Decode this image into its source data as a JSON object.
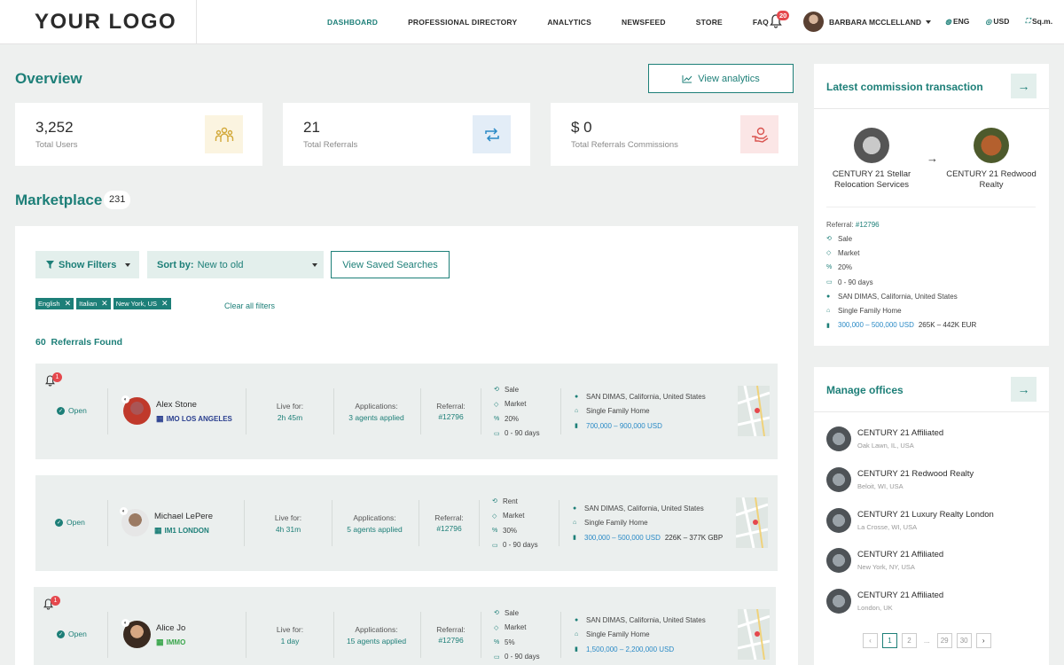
{
  "header": {
    "logo": "YOUR LOGO",
    "nav": [
      "DASHBOARD",
      "PROFESSIONAL DIRECTORY",
      "ANALYTICS",
      "NEWSFEED",
      "STORE",
      "FAQ"
    ],
    "notification_count": "20",
    "user_name": "BARBARA MCCLELLAND",
    "language": "ENG",
    "currency": "USD",
    "unit": "Sq.m."
  },
  "overview": {
    "title": "Overview",
    "view_analytics": "View analytics",
    "stats": [
      {
        "value": "3,252",
        "label": "Total Users",
        "icon": "users-icon"
      },
      {
        "value": "21",
        "label": "Total Referrals",
        "icon": "repeat-icon"
      },
      {
        "value": "$ 0",
        "label": "Total Referrals Commissions",
        "icon": "hand-coin-icon"
      }
    ]
  },
  "marketplace": {
    "title": "Marketplace",
    "count": "231",
    "show_filters": "Show Filters",
    "sort_label": "Sort by:",
    "sort_value": "New to old",
    "saved_searches": "View Saved Searches",
    "chips": [
      "English",
      "Italian",
      "New York, US"
    ],
    "clear_filters": "Clear all filters",
    "found_count": "60",
    "found_label": "Referrals Found",
    "listings": [
      {
        "notif": "1",
        "status": "Open",
        "agent": "Alex Stone",
        "office": "IMO LOS ANGELES",
        "office_color": "#2a3f8f",
        "live_label": "Live for:",
        "live": "2h 45m",
        "apps_label": "Applications:",
        "apps": "3 agents applied",
        "ref_label": "Referral:",
        "ref": "#12796",
        "type": "Sale",
        "price_basis": "Market",
        "commission": "20%",
        "timeframe": "0 - 90 days",
        "location": "SAN DIMAS, California, United States",
        "property": "Single Family Home",
        "price": "700,000 – 900,000 USD",
        "price_alt": ""
      },
      {
        "notif": "",
        "status": "Open",
        "agent": "Michael LePere",
        "office": "IM1 LONDON",
        "office_color": "#1d7f78",
        "live_label": "Live for:",
        "live": "4h 31m",
        "apps_label": "Applications:",
        "apps": "5 agents applied",
        "ref_label": "Referral:",
        "ref": "#12796",
        "type": "Rent",
        "price_basis": "Market",
        "commission": "30%",
        "timeframe": "0 - 90 days",
        "location": "SAN DIMAS, California, United States",
        "property": "Single Family Home",
        "price": "300,000 – 500,000 USD",
        "price_alt": "226K – 377K GBP"
      },
      {
        "notif": "1",
        "status": "Open",
        "agent": "Alice Jo",
        "office": "IMMO",
        "office_color": "#3aa64c",
        "live_label": "Live for:",
        "live": "1 day",
        "apps_label": "Applications:",
        "apps": "15 agents applied",
        "ref_label": "Referral:",
        "ref": "#12796",
        "type": "Sale",
        "price_basis": "Market",
        "commission": "5%",
        "timeframe": "0 - 90 days",
        "location": "SAN DIMAS, California, United States",
        "property": "Single Family Home",
        "price": "1,500,000 – 2,200,000 USD",
        "price_alt": ""
      }
    ]
  },
  "commission": {
    "title": "Latest commission transaction",
    "from": "CENTURY 21 Stellar Relocation Services",
    "to": "CENTURY 21 Redwood Realty",
    "ref_label": "Referral:",
    "ref": "#12796",
    "details": [
      "Sale",
      "Market",
      "20%",
      "0 - 90 days",
      "SAN DIMAS, California, United States",
      "Single Family Home"
    ],
    "price": "300,000 – 500,000 USD",
    "price_alt": "265K – 442K EUR"
  },
  "offices": {
    "title": "Manage offices",
    "items": [
      {
        "name": "CENTURY 21 Affiliated",
        "location": "Oak Lawn, IL, USA"
      },
      {
        "name": "CENTURY 21 Redwood Realty",
        "location": "Beloit, WI, USA"
      },
      {
        "name": "CENTURY 21 Luxury Realty London",
        "location": "La Crosse, WI, USA"
      },
      {
        "name": "CENTURY 21 Affiliated",
        "location": "New York, NY, USA"
      },
      {
        "name": "CENTURY 21 Affiliated",
        "location": "London, UK"
      }
    ],
    "pages": [
      "1",
      "2",
      "...",
      "29",
      "30"
    ]
  }
}
